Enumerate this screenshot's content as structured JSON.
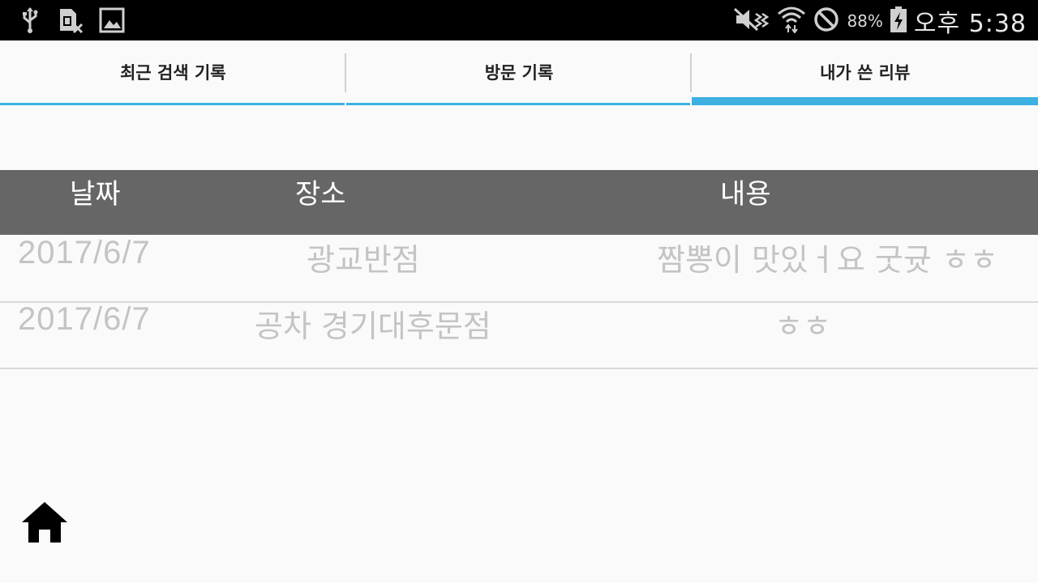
{
  "status_bar": {
    "battery_percent": "88%",
    "time": "오후 5:38",
    "left_icons": [
      "usb-icon",
      "sim-error-icon",
      "image-icon"
    ],
    "right_icons": [
      "mute-icon",
      "wifi-icon",
      "blocked-icon",
      "battery-charging-icon"
    ]
  },
  "tabs": [
    {
      "label": "최근 검색 기록",
      "active": false
    },
    {
      "label": "방문 기록",
      "active": false
    },
    {
      "label": "내가 쓴 리뷰",
      "active": true
    }
  ],
  "table": {
    "headers": {
      "date": "날짜",
      "place": "장소",
      "content": "내용"
    },
    "rows": [
      {
        "date": "2017/6/7",
        "place": "광교반점",
        "content": "짬뽕이 맛있ㅓ요 굿귯 ㅎㅎ"
      },
      {
        "date": "2017/6/7",
        "place": "공차 경기대후문점",
        "content": "ㅎㅎ"
      }
    ]
  },
  "accent_color": "#3cb0e0",
  "home_button": {
    "icon": "home-icon"
  }
}
